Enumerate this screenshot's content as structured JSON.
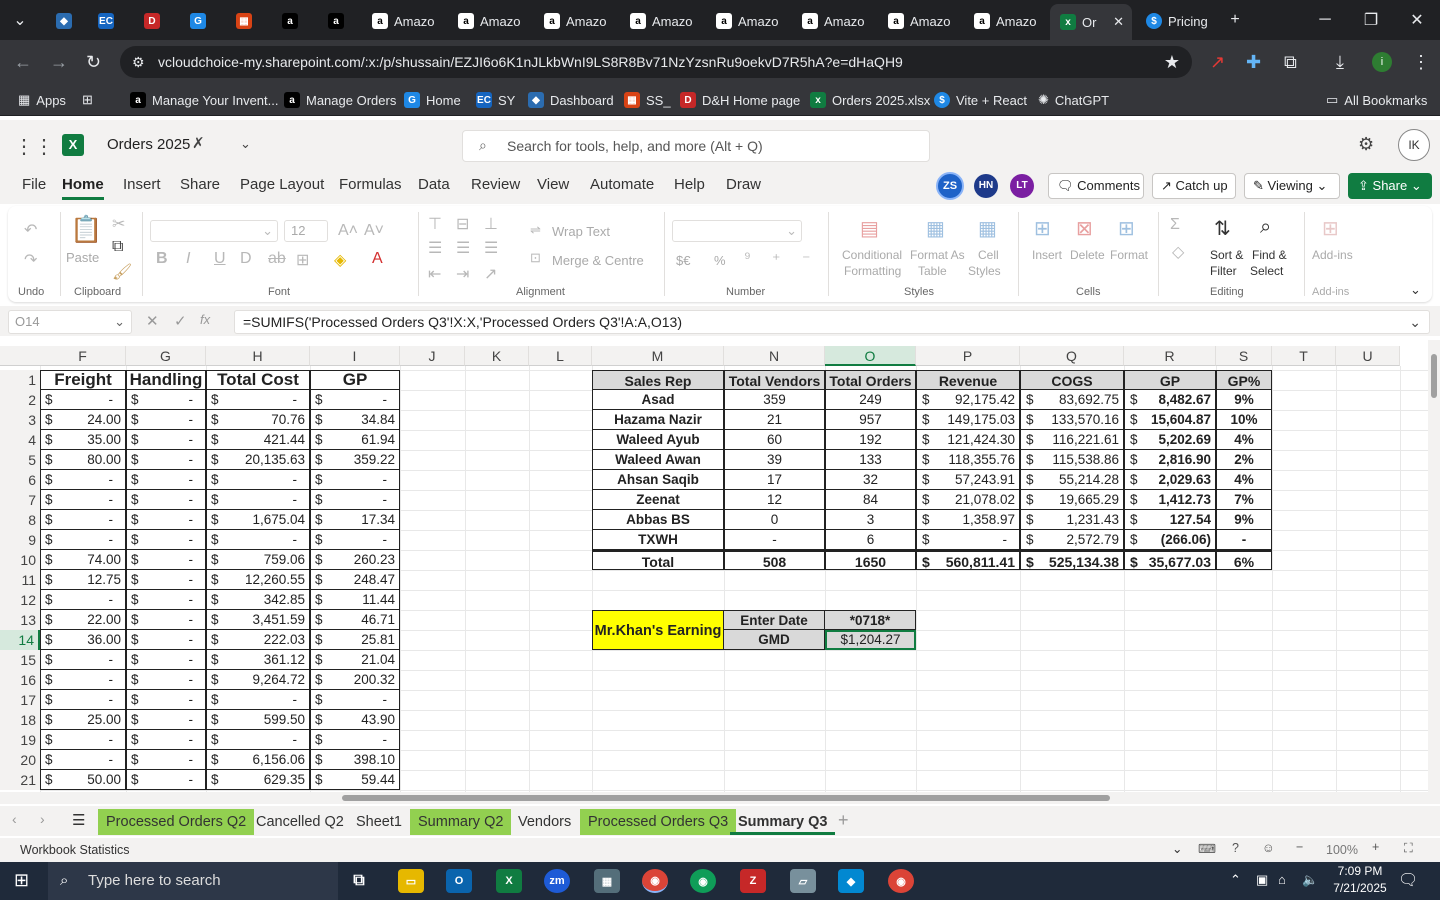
{
  "browser": {
    "tabs": [
      {
        "label": "Amazo",
        "icon": "amazon-icon"
      },
      {
        "label": "Amazo",
        "icon": "amazon-icon"
      },
      {
        "label": "Amazo",
        "icon": "amazon-icon"
      },
      {
        "label": "Amazo",
        "icon": "amazon-icon"
      },
      {
        "label": "Amazo",
        "icon": "amazon-icon"
      },
      {
        "label": "Amazo",
        "icon": "amazon-icon"
      },
      {
        "label": "Amazo",
        "icon": "amazon-icon"
      },
      {
        "label": "Amazo",
        "icon": "amazon-icon"
      },
      {
        "label": "Or",
        "icon": "excel-icon"
      },
      {
        "label": "Pricing",
        "icon": "dollar-icon"
      }
    ],
    "url": "vcloudchoice-my.sharepoint.com/:x:/p/shussain/EZJI6o6K1nJLkbWnI9LS8R8Bv71NzYzsnRu9oekvD7R5hA?e=dHaQH9",
    "bookmarks": [
      "Apps",
      "Manage Your Invent...",
      "Manage Orders",
      "Home",
      "SY",
      "Dashboard",
      "SS_",
      "D&H Home page",
      "Orders 2025.xlsx",
      "Vite + React",
      "ChatGPT"
    ],
    "all_bookmarks": "All Bookmarks"
  },
  "excel": {
    "file_name": "Orders 2025",
    "search_placeholder": "Search for tools, help, and more (Alt + Q)",
    "user_initials": "IK",
    "collaborators": [
      "ZS",
      "HN",
      "LT"
    ],
    "menu": [
      "File",
      "Home",
      "Insert",
      "Share",
      "Page Layout",
      "Formulas",
      "Data",
      "Review",
      "View",
      "Automate",
      "Help",
      "Draw"
    ],
    "comments_label": "Comments",
    "catchup_label": "Catch up",
    "viewing_label": "Viewing",
    "share_label": "Share",
    "ribbon": {
      "undo": "Undo",
      "paste": "Paste",
      "clipboard": "Clipboard",
      "font_size": "12",
      "font": "Font",
      "wrap_text": "Wrap Text",
      "merge_centre": "Merge & Centre",
      "alignment": "Alignment",
      "number": "Number",
      "conditional_formatting_1": "Conditional",
      "conditional_formatting_2": "Formatting",
      "format_as_table_1": "Format As",
      "format_as_table_2": "Table",
      "cell_styles_1": "Cell",
      "cell_styles_2": "Styles",
      "styles": "Styles",
      "insert": "Insert",
      "delete": "Delete",
      "format": "Format",
      "cells": "Cells",
      "sort_filter_1": "Sort &",
      "sort_filter_2": "Filter",
      "find_select_1": "Find &",
      "find_select_2": "Select",
      "editing": "Editing",
      "addins": "Add-ins",
      "addins_group": "Add-ins",
      "currency": "$€",
      "percent": "%"
    },
    "name_box": "O14",
    "formula": "=SUMIFS('Processed Orders Q3'!X:X,'Processed Orders Q3'!A:A,O13)",
    "columns": [
      "F",
      "G",
      "H",
      "I",
      "J",
      "K",
      "L",
      "M",
      "N",
      "O",
      "P",
      "Q",
      "R",
      "S",
      "T",
      "U"
    ],
    "rows": [
      "1",
      "2",
      "3",
      "4",
      "5",
      "6",
      "7",
      "8",
      "9",
      "10",
      "11",
      "12",
      "13",
      "14",
      "15",
      "16",
      "17",
      "18",
      "19",
      "20",
      "21"
    ],
    "left_headers": [
      "Freight",
      "Handling",
      "Total Cost",
      "GP"
    ],
    "left_rows": [
      [
        "-",
        "-",
        "-",
        "-"
      ],
      [
        "24.00",
        "-",
        "70.76",
        "34.84"
      ],
      [
        "35.00",
        "-",
        "421.44",
        "61.94"
      ],
      [
        "80.00",
        "-",
        "20,135.63",
        "359.22"
      ],
      [
        "-",
        "-",
        "-",
        "-"
      ],
      [
        "-",
        "-",
        "-",
        "-"
      ],
      [
        "-",
        "-",
        "1,675.04",
        "17.34"
      ],
      [
        "-",
        "-",
        "-",
        "-"
      ],
      [
        "74.00",
        "-",
        "759.06",
        "260.23"
      ],
      [
        "12.75",
        "-",
        "12,260.55",
        "248.47"
      ],
      [
        "-",
        "-",
        "342.85",
        "11.44"
      ],
      [
        "22.00",
        "-",
        "3,451.59",
        "46.71"
      ],
      [
        "36.00",
        "-",
        "222.03",
        "25.81"
      ],
      [
        "-",
        "-",
        "361.12",
        "21.04"
      ],
      [
        "-",
        "-",
        "9,264.72",
        "200.32"
      ],
      [
        "-",
        "-",
        "-",
        "-"
      ],
      [
        "25.00",
        "-",
        "599.50",
        "43.90"
      ],
      [
        "-",
        "-",
        "-",
        "-"
      ],
      [
        "-",
        "-",
        "6,156.06",
        "398.10"
      ],
      [
        "50.00",
        "-",
        "629.35",
        "59.44"
      ]
    ],
    "summary_headers": [
      "Sales Rep",
      "Total Vendors",
      "Total Orders",
      "Revenue",
      "COGS",
      "GP",
      "GP%"
    ],
    "summary_rows": [
      [
        "Asad",
        "359",
        "249",
        "92,175.42",
        "83,692.75",
        "8,482.67",
        "9%"
      ],
      [
        "Hazama Nazir",
        "21",
        "957",
        "149,175.03",
        "133,570.16",
        "15,604.87",
        "10%"
      ],
      [
        "Waleed Ayub",
        "60",
        "192",
        "121,424.30",
        "116,221.61",
        "5,202.69",
        "4%"
      ],
      [
        "Waleed Awan",
        "39",
        "133",
        "118,355.76",
        "115,538.86",
        "2,816.90",
        "2%"
      ],
      [
        "Ahsan Saqib",
        "17",
        "32",
        "57,243.91",
        "55,214.28",
        "2,029.63",
        "4%"
      ],
      [
        "Zeenat",
        "12",
        "84",
        "21,078.02",
        "19,665.29",
        "1,412.73",
        "7%"
      ],
      [
        "Abbas BS",
        "0",
        "3",
        "1,358.97",
        "1,231.43",
        "127.54",
        "9%"
      ],
      [
        "TXWH",
        "-",
        "6",
        "-",
        "2,572.79",
        "(266.06)",
        "-"
      ],
      [
        "Total",
        "508",
        "1650",
        "560,811.41",
        "525,134.38",
        "35,677.03",
        "6%"
      ]
    ],
    "dollar": "$",
    "earning_label": "Mr.Khan's Earning",
    "enter_date_label": "Enter Date",
    "enter_date_value": "*0718*",
    "gmd_label": "GMD",
    "gmd_value": "$1,204.27",
    "sheet_tabs": [
      {
        "label": "Processed Orders Q2",
        "style": "green"
      },
      {
        "label": "Cancelled Q2",
        "style": "plain"
      },
      {
        "label": "Sheet1",
        "style": "plain"
      },
      {
        "label": "Summary Q2",
        "style": "green"
      },
      {
        "label": "Vendors",
        "style": "plain"
      },
      {
        "label": "Processed Orders Q3",
        "style": "green"
      },
      {
        "label": "Summary Q3",
        "style": "active"
      }
    ],
    "status_left": "Workbook Statistics",
    "zoom": "100%"
  },
  "taskbar": {
    "search_placeholder": "Type here to search",
    "time": "7:09 PM",
    "date": "7/21/2025"
  },
  "colors": {
    "excel_green": "#107c41",
    "sheet_green": "#92d050",
    "highlight_yellow": "#ffff00",
    "header_gray": "#d9d9d9"
  }
}
